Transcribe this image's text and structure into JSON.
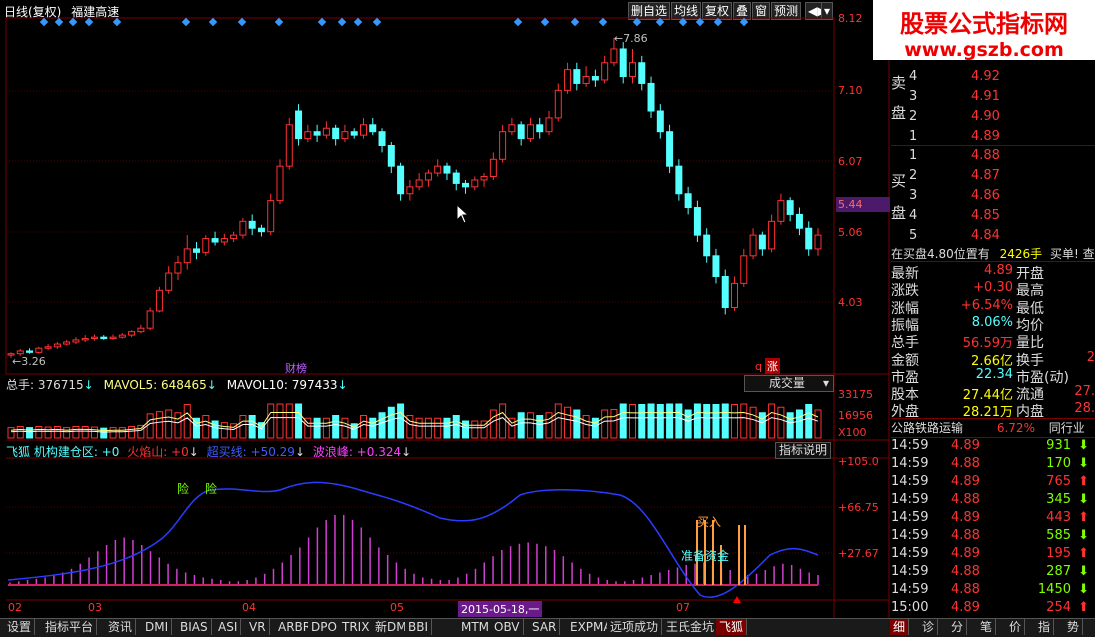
{
  "toolbar": {
    "title": "日线(复权)",
    "stock": "福建高速",
    "buttons": [
      "删自选",
      "均线",
      "复权",
      "叠",
      "窗",
      "预测"
    ]
  },
  "watermark": {
    "cn": "股票公式指标网",
    "url": "www.gszb.com"
  },
  "main_chart": {
    "price_axis": [
      "8.12",
      "7.10",
      "6.07",
      "5.06",
      "4.03"
    ],
    "price_tag": "5.44",
    "high_label": "7.86",
    "low_label": "3.26",
    "markers": {
      "caibang": "财榜",
      "q": "q",
      "zhang": "涨"
    },
    "candles": [
      [
        3.26,
        3.28,
        3.22,
        3.3
      ],
      [
        3.28,
        3.32,
        3.25,
        3.35
      ],
      [
        3.32,
        3.3,
        3.28,
        3.36
      ],
      [
        3.3,
        3.36,
        3.28,
        3.38
      ],
      [
        3.36,
        3.38,
        3.33,
        3.42
      ],
      [
        3.38,
        3.42,
        3.35,
        3.45
      ],
      [
        3.42,
        3.45,
        3.4,
        3.48
      ],
      [
        3.45,
        3.48,
        3.42,
        3.52
      ],
      [
        3.48,
        3.5,
        3.45,
        3.55
      ],
      [
        3.5,
        3.52,
        3.47,
        3.56
      ],
      [
        3.52,
        3.5,
        3.48,
        3.55
      ],
      [
        3.5,
        3.52,
        3.48,
        3.56
      ],
      [
        3.52,
        3.55,
        3.5,
        3.58
      ],
      [
        3.55,
        3.6,
        3.52,
        3.62
      ],
      [
        3.6,
        3.65,
        3.58,
        3.7
      ],
      [
        3.65,
        3.9,
        3.62,
        3.95
      ],
      [
        3.9,
        4.2,
        3.88,
        4.25
      ],
      [
        4.2,
        4.45,
        4.15,
        4.55
      ],
      [
        4.45,
        4.6,
        4.35,
        4.7
      ],
      [
        4.6,
        4.8,
        4.5,
        5.0
      ],
      [
        4.8,
        4.75,
        4.65,
        4.9
      ],
      [
        4.75,
        4.95,
        4.7,
        5.0
      ],
      [
        4.95,
        4.9,
        4.85,
        5.05
      ],
      [
        4.9,
        4.95,
        4.85,
        5.02
      ],
      [
        4.95,
        5.0,
        4.9,
        5.05
      ],
      [
        5.0,
        5.2,
        4.95,
        5.25
      ],
      [
        5.2,
        5.1,
        5.0,
        5.3
      ],
      [
        5.1,
        5.05,
        4.98,
        5.15
      ],
      [
        5.05,
        5.5,
        5.0,
        5.6
      ],
      [
        5.5,
        6.0,
        5.45,
        6.1
      ],
      [
        6.0,
        6.6,
        5.95,
        6.7
      ],
      [
        6.8,
        6.4,
        6.3,
        6.9
      ],
      [
        6.4,
        6.5,
        6.35,
        6.6
      ],
      [
        6.5,
        6.45,
        6.35,
        6.6
      ],
      [
        6.45,
        6.55,
        6.4,
        6.65
      ],
      [
        6.55,
        6.4,
        6.3,
        6.6
      ],
      [
        6.4,
        6.5,
        6.35,
        6.6
      ],
      [
        6.5,
        6.45,
        6.4,
        6.55
      ],
      [
        6.45,
        6.6,
        6.4,
        6.7
      ],
      [
        6.6,
        6.5,
        6.45,
        6.7
      ],
      [
        6.5,
        6.3,
        6.2,
        6.55
      ],
      [
        6.3,
        6.0,
        5.9,
        6.35
      ],
      [
        6.0,
        5.6,
        5.5,
        6.05
      ],
      [
        5.6,
        5.7,
        5.5,
        5.8
      ],
      [
        5.7,
        5.8,
        5.65,
        5.9
      ],
      [
        5.8,
        5.9,
        5.7,
        5.95
      ],
      [
        5.9,
        6.0,
        5.85,
        6.1
      ],
      [
        6.0,
        5.9,
        5.8,
        6.05
      ],
      [
        5.9,
        5.75,
        5.65,
        5.95
      ],
      [
        5.75,
        5.7,
        5.6,
        5.8
      ],
      [
        5.7,
        5.8,
        5.65,
        5.85
      ],
      [
        5.8,
        5.85,
        5.7,
        5.9
      ],
      [
        5.85,
        6.1,
        5.8,
        6.2
      ],
      [
        6.1,
        6.5,
        6.05,
        6.6
      ],
      [
        6.5,
        6.6,
        6.45,
        6.7
      ],
      [
        6.6,
        6.4,
        6.3,
        6.65
      ],
      [
        6.4,
        6.6,
        6.35,
        6.7
      ],
      [
        6.6,
        6.5,
        6.4,
        6.7
      ],
      [
        6.5,
        6.7,
        6.45,
        6.8
      ],
      [
        6.7,
        7.1,
        6.65,
        7.2
      ],
      [
        7.1,
        7.4,
        7.05,
        7.5
      ],
      [
        7.4,
        7.2,
        7.1,
        7.5
      ],
      [
        7.2,
        7.3,
        7.15,
        7.45
      ],
      [
        7.3,
        7.25,
        7.15,
        7.4
      ],
      [
        7.25,
        7.5,
        7.2,
        7.6
      ],
      [
        7.5,
        7.7,
        7.45,
        7.86
      ],
      [
        7.7,
        7.3,
        7.2,
        7.8
      ],
      [
        7.3,
        7.5,
        7.2,
        7.7
      ],
      [
        7.5,
        7.2,
        7.1,
        7.6
      ],
      [
        7.2,
        6.8,
        6.7,
        7.3
      ],
      [
        6.8,
        6.5,
        6.4,
        6.9
      ],
      [
        6.5,
        6.0,
        5.9,
        6.6
      ],
      [
        6.0,
        5.6,
        5.5,
        6.1
      ],
      [
        5.6,
        5.4,
        5.3,
        5.7
      ],
      [
        5.4,
        5.0,
        4.9,
        5.5
      ],
      [
        5.0,
        4.7,
        4.6,
        5.1
      ],
      [
        4.7,
        4.4,
        4.3,
        4.8
      ],
      [
        4.4,
        3.95,
        3.85,
        4.5
      ],
      [
        3.95,
        4.3,
        3.9,
        4.4
      ],
      [
        4.3,
        4.7,
        4.25,
        4.8
      ],
      [
        4.7,
        5.0,
        4.65,
        5.1
      ],
      [
        5.0,
        4.8,
        4.7,
        5.05
      ],
      [
        4.8,
        5.2,
        4.75,
        5.3
      ],
      [
        5.2,
        5.5,
        5.15,
        5.6
      ],
      [
        5.5,
        5.3,
        5.2,
        5.55
      ],
      [
        5.3,
        5.1,
        5.0,
        5.4
      ],
      [
        5.1,
        4.8,
        4.7,
        5.2
      ],
      [
        4.8,
        5.0,
        4.7,
        5.1
      ]
    ]
  },
  "volume": {
    "label": "总手: 376715",
    "mavol5": "MAVOL5: 648465",
    "mavol10": "MAVOL10: 797433",
    "selector": "成交量",
    "axis": [
      "33175",
      "16956",
      "X100"
    ]
  },
  "indicator": {
    "title": "飞狐 机构建仓区: +0",
    "huoyanshan": "火焰山: +0",
    "chaomaixian": "超买线: +50.29",
    "bolangfeng": "波浪峰: +0.324",
    "help_btn": "指标说明",
    "axis": [
      "+105.0",
      "+66.75",
      "+27.67"
    ],
    "labels": {
      "xian1": "险",
      "xian2": "险",
      "mairu": "买入",
      "zhunbei": "准备资金"
    },
    "bars": [
      2,
      3,
      4,
      5,
      6,
      8,
      10,
      13,
      17,
      22,
      27,
      32,
      36,
      38,
      36,
      32,
      27,
      22,
      17,
      13,
      10,
      8,
      6,
      5,
      4,
      3,
      3,
      4,
      6,
      9,
      13,
      18,
      24,
      30,
      38,
      46,
      52,
      56,
      56,
      52,
      46,
      38,
      30,
      24,
      18,
      13,
      9,
      6,
      5,
      4,
      4,
      6,
      9,
      13,
      18,
      23,
      28,
      31,
      33,
      34,
      33,
      31,
      28,
      23,
      18,
      13,
      9,
      6,
      4,
      3,
      3,
      4,
      6,
      8,
      10,
      12,
      14,
      16,
      17,
      18,
      16,
      14,
      12,
      10,
      8,
      9,
      12,
      15,
      17,
      16,
      13,
      10,
      8
    ]
  },
  "date_axis": {
    "labels": [
      "02",
      "03",
      "04",
      "05",
      "07"
    ],
    "highlight": "2015-05-18,一"
  },
  "order_book": {
    "sell_label_top": "卖",
    "sell_label_bot": "盘",
    "buy_label_top": "买",
    "buy_label_bot": "盘",
    "sells": [
      {
        "n": "4",
        "p": "4.92"
      },
      {
        "n": "3",
        "p": "4.91"
      },
      {
        "n": "2",
        "p": "4.90"
      },
      {
        "n": "1",
        "p": "4.89"
      }
    ],
    "buys": [
      {
        "n": "1",
        "p": "4.88"
      },
      {
        "n": "2",
        "p": "4.87"
      },
      {
        "n": "3",
        "p": "4.86"
      },
      {
        "n": "4",
        "p": "4.85"
      },
      {
        "n": "5",
        "p": "4.84"
      }
    ],
    "note": "在买盘4.80位置有",
    "note_qty": "2426手",
    "note_tail": "买单! 查看"
  },
  "quote": [
    {
      "l": "最新",
      "v": "4.89",
      "r": "开盘",
      "rv": ""
    },
    {
      "l": "涨跌",
      "v": "+0.30",
      "r": "最高",
      "rv": ""
    },
    {
      "l": "涨幅",
      "v": "+6.54%",
      "r": "最低",
      "rv": ""
    },
    {
      "l": "振幅",
      "v": "8.06%",
      "r": "均价",
      "rv": ""
    },
    {
      "l": "总手",
      "v": "56.59万",
      "r": "量比",
      "rv": ""
    },
    {
      "l": "金额",
      "v": "2.66亿",
      "r": "换手",
      "rv": "2"
    },
    {
      "l": "市盈",
      "v": "22.34",
      "r": "市盈(动)",
      "rv": ""
    },
    {
      "l": "股本",
      "v": "27.44亿",
      "r": "流通",
      "rv": "27."
    },
    {
      "l": "外盘",
      "v": "28.21万",
      "r": "内盘",
      "rv": "28."
    }
  ],
  "industry": {
    "name": "公路铁路运输",
    "pct": "6.72%",
    "link": "同行业"
  },
  "trades": [
    {
      "t": "14:59",
      "p": "4.89",
      "q": "931",
      "d": "down"
    },
    {
      "t": "14:59",
      "p": "4.88",
      "q": "170",
      "d": "down"
    },
    {
      "t": "14:59",
      "p": "4.89",
      "q": "765",
      "d": "up"
    },
    {
      "t": "14:59",
      "p": "4.88",
      "q": "345",
      "d": "down"
    },
    {
      "t": "14:59",
      "p": "4.89",
      "q": "443",
      "d": "up"
    },
    {
      "t": "14:59",
      "p": "4.88",
      "q": "585",
      "d": "down"
    },
    {
      "t": "14:59",
      "p": "4.89",
      "q": "195",
      "d": "up"
    },
    {
      "t": "14:59",
      "p": "4.88",
      "q": "287",
      "d": "down"
    },
    {
      "t": "14:59",
      "p": "4.88",
      "q": "1450",
      "d": "down"
    },
    {
      "t": "15:00",
      "p": "4.89",
      "q": "254",
      "d": "up"
    }
  ],
  "tabs": [
    "设置",
    "指标平台",
    "资讯",
    "DMI",
    "BIAS",
    "ASI",
    "VR",
    "ARBR",
    "DPO",
    "TRIX",
    "新DMA",
    "BBI",
    "MTM",
    "OBV",
    "SAR",
    "EXPMA",
    "远项成功",
    "王氏金坑",
    "飞狐"
  ],
  "right_tabs": [
    "细",
    "诊",
    "分",
    "笔",
    "价",
    "指",
    "势"
  ],
  "colors": {
    "up": "#ff3232",
    "down": "#54ffff",
    "bg": "#000000",
    "grid": "#7a0000"
  }
}
